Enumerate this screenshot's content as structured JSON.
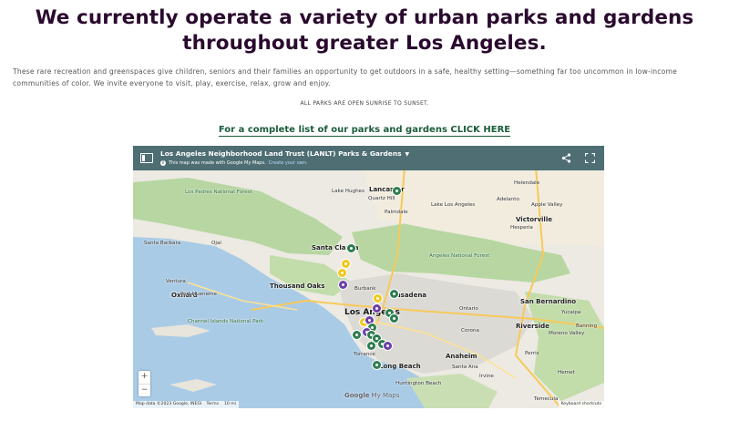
{
  "page": {
    "headline": "We currently operate a variety of urban parks and gardens throughout greater Los Angeles.",
    "intro": "These rare recreation and greenspaces give children, seniors and their families an opportunity to get outdoors in a safe, healthy setting—something far too uncommon in low-income communities of color. We invite everyone to visit, play, exercise, relax, grow and enjoy.",
    "hours": "ALL PARKS ARE OPEN SUNRISE TO SUNSET.",
    "cta": "For a complete list of our parks and gardens CLICK HERE"
  },
  "map": {
    "title": "Los Angeles Neighborhood Land Trust (LANLT) Parks & Gardens",
    "subtitle": "This map was made with Google My Maps.",
    "create_link": "Create your own.",
    "zoom_in": "+",
    "zoom_out": "−",
    "attribution": "Map data ©2023 Google, INEGI",
    "terms": "Terms",
    "scale": "10 mi",
    "shortcuts": "Keyboard shortcuts",
    "logo_google": "Google",
    "logo_mymaps": "My Maps",
    "places": [
      {
        "name": "Lancaster",
        "cls": "big"
      },
      {
        "name": "Quartz Hill",
        "cls": ""
      },
      {
        "name": "Lake Hughes",
        "cls": ""
      },
      {
        "name": "Lake Los Angeles",
        "cls": ""
      },
      {
        "name": "Palmdale",
        "cls": ""
      },
      {
        "name": "Helendale",
        "cls": ""
      },
      {
        "name": "Adelanto",
        "cls": ""
      },
      {
        "name": "Apple Valley",
        "cls": ""
      },
      {
        "name": "Victorville",
        "cls": "big"
      },
      {
        "name": "Hesperia",
        "cls": ""
      },
      {
        "name": "Los Padres National Forest",
        "cls": "forest"
      },
      {
        "name": "Santa Barbara",
        "cls": ""
      },
      {
        "name": "Ojai",
        "cls": ""
      },
      {
        "name": "Santa Clarita",
        "cls": "big"
      },
      {
        "name": "Ventura",
        "cls": ""
      },
      {
        "name": "Oxnard",
        "cls": "big"
      },
      {
        "name": "Thousand Oaks",
        "cls": "big"
      },
      {
        "name": "Port Hueneme",
        "cls": ""
      },
      {
        "name": "Burbank",
        "cls": ""
      },
      {
        "name": "Angeles National Forest",
        "cls": "forest"
      },
      {
        "name": "Pasadena",
        "cls": "big"
      },
      {
        "name": "Los Angeles",
        "cls": "huge"
      },
      {
        "name": "Ontario",
        "cls": ""
      },
      {
        "name": "San Bernardino",
        "cls": "big"
      },
      {
        "name": "Riverside",
        "cls": "big"
      },
      {
        "name": "Moreno Valley",
        "cls": ""
      },
      {
        "name": "Torrance",
        "cls": ""
      },
      {
        "name": "Anaheim",
        "cls": "big"
      },
      {
        "name": "Long Beach",
        "cls": "big"
      },
      {
        "name": "Huntington Beach",
        "cls": ""
      },
      {
        "name": "Santa Ana",
        "cls": ""
      },
      {
        "name": "Irvine",
        "cls": ""
      },
      {
        "name": "Hemet",
        "cls": ""
      },
      {
        "name": "Perris",
        "cls": ""
      },
      {
        "name": "Temecula",
        "cls": ""
      },
      {
        "name": "Corona",
        "cls": ""
      },
      {
        "name": "Banning",
        "cls": ""
      },
      {
        "name": "Yucaipa",
        "cls": ""
      },
      {
        "name": "Channel Islands National Park",
        "cls": "forest"
      }
    ]
  },
  "colors": {
    "headline": "#2a0a2e",
    "cta": "#1a5c3a",
    "map_header": "#4e6e74",
    "pin_green": "#2e7d4f",
    "pin_purple": "#6c3fa8",
    "pin_yellow": "#f2c81b"
  }
}
